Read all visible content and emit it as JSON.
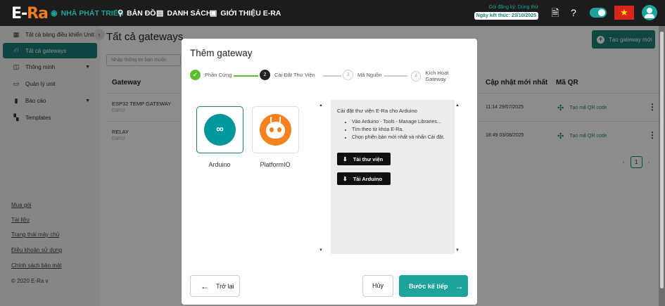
{
  "topbar": {
    "logo_main": "E-",
    "logo_accent": "Ra",
    "nav": [
      "NHÀ PHÁT TRIỂN",
      "BẢN ĐỒ",
      "DANH SÁCH",
      "GIỚI THIỆU E-RA"
    ],
    "registration_plan": "Gói đăng ký: Dùng thử",
    "registration_end": "Ngày kết thúc: 23/10/2025",
    "flag_star": "★"
  },
  "sidebar": {
    "items": [
      {
        "label": "Tất cả bảng điều khiển Units"
      },
      {
        "label": "Tất cả gateways"
      },
      {
        "label": "Thông minh"
      },
      {
        "label": "Quản lý unit"
      },
      {
        "label": "Báo cáo"
      },
      {
        "label": "Templates"
      }
    ],
    "links": [
      "Mua gói",
      "Tài liệu",
      "Trạng thái máy chủ",
      "Điều khoản sử dụng",
      "Chính sách bảo mật"
    ],
    "copyright": "© 2020 E-Ra v"
  },
  "main": {
    "title": "Tất cả gateways",
    "create_button": "Tạo gateway mới",
    "search_placeholder": "Nhập thông tin bạn muốn",
    "columns": {
      "gateway": "Gateway",
      "updated": "Cập nhật mới nhất",
      "qr": "Mã QR"
    },
    "rows": [
      {
        "name": "ESP32 TEMP GATEWAY",
        "type": "ESP32",
        "updated": "11:14 29/07/2025",
        "qr": "Tạo mã QR code"
      },
      {
        "name": "RELAY",
        "type": "ESP32",
        "updated": "18:49 03/08/2025",
        "qr": "Tạo mã QR code"
      }
    ],
    "page": "1"
  },
  "modal": {
    "title": "Thêm gateway",
    "steps": [
      {
        "num": "✓",
        "label": "Phần Cứng"
      },
      {
        "num": "2",
        "label": "Cài Đặt Thư Viện"
      },
      {
        "num": "3",
        "label": "Mã Nguồn"
      },
      {
        "num": "4",
        "label": "Kích Hoạt Gateway"
      }
    ],
    "boards": [
      {
        "label": "Arduino",
        "logo": "∞"
      },
      {
        "label": "PlatformIO"
      }
    ],
    "panel": {
      "title": "Cài đặt thư viện E-Ra cho Arduino",
      "bullets": [
        "Vào Arduino - Tools - Manage Libraries...",
        "Tìm theo từ khóa E-Ra.",
        "Chọn phiên bản mới nhất và nhấn Cài đặt."
      ],
      "download_library": "Tải thư viện",
      "download_arduino": "Tải Arduino"
    },
    "back_button": "Trở lại",
    "cancel_button": "Hủy",
    "next_button": "Bước kế tiếp"
  }
}
